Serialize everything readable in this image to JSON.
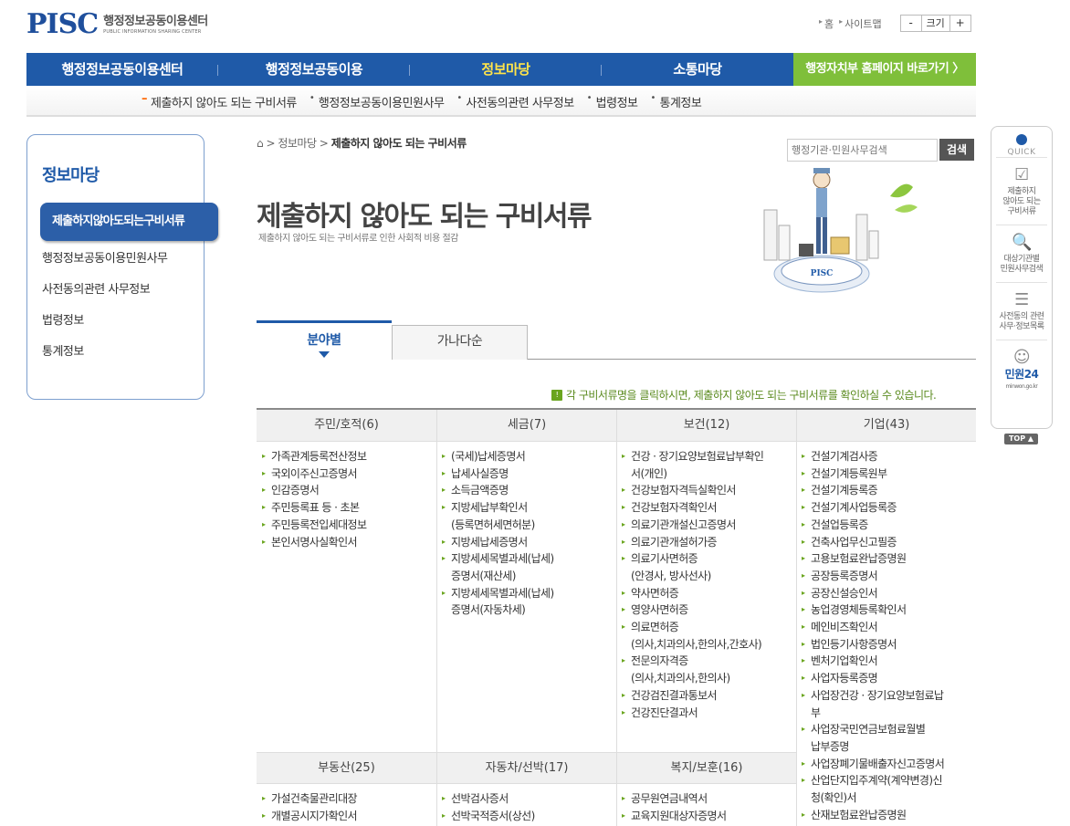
{
  "header": {
    "logo_mark": "PISC",
    "logo_ko": "행정정보공동이용센터",
    "logo_en": "PUBLIC INFORMATION SHARING CENTER",
    "util_home": "홈",
    "util_sitemap": "사이트맵",
    "font_minus": "-",
    "font_label": "크기",
    "font_plus": "+"
  },
  "gnb": {
    "items": [
      "행정정보공동이용센터",
      "행정정보공동이용",
      "정보마당",
      "소통마당"
    ],
    "gov_link": "행정자치부 홈페이지 바로가기 〉"
  },
  "subnav": [
    "제출하지 않아도 되는 구비서류",
    "행정정보공동이용민원사무",
    "사전동의관련 사무정보",
    "법령정보",
    "통계정보"
  ],
  "lnb": {
    "title": "정보마당",
    "active": "제출하지않아도되는구비서류",
    "items": [
      "행정정보공동이용민원사무",
      "사전동의관련 사무정보",
      "법령정보",
      "통계정보"
    ]
  },
  "breadcrumb": {
    "home": "⌂",
    "path": "> 정보마당 >",
    "current": "제출하지 않아도 되는 구비서류"
  },
  "search": {
    "placeholder": "행정기관·민원사무검색",
    "button": "검색"
  },
  "page": {
    "title": "제출하지 않아도 되는 구비서류",
    "subtitle": "제출하지 않아도 되는 구비서류로 인한 사회적 비용 절감",
    "illus_label": "PISC"
  },
  "tabs": [
    "분야별",
    "가나다순"
  ],
  "notice": {
    "icon": "!",
    "text": "각 구비서류명을 클릭하시면, 제출하지 않아도 되는 구비서류를 확인하실 수 있습니다."
  },
  "categories": {
    "c1": {
      "header": "주민/호적(6)",
      "items": [
        "가족관계등록전산정보",
        "국외이주신고증명서",
        "인감증명서",
        "주민등록표 등 · 초본",
        "주민등록전입세대정보",
        "본인서명사실확인서"
      ]
    },
    "c2": {
      "header": "세금(7)",
      "items": [
        "(국세)납세증명서",
        "납세사실증명",
        "소득금액증명",
        [
          "지방세납부확인서",
          "(등록면허세면허분)"
        ],
        "지방세납세증명서",
        [
          "지방세세목별과세(납세)",
          "증명서(재산세)"
        ],
        [
          "지방세세목별과세(납세)",
          "증명서(자동차세)"
        ]
      ]
    },
    "c3": {
      "header": "보건(12)",
      "items": [
        [
          "건강 · 장기요양보험료납부확인",
          "서(개인)"
        ],
        "건강보험자격득실확인서",
        "건강보험자격확인서",
        "의료기관개설신고증명서",
        "의료기관개설허가증",
        [
          "의료기사면허증",
          "(안경사, 방사선사)"
        ],
        "약사면허증",
        "영양사면허증",
        [
          "의료면허증",
          "(의사,치과의사,한의사,간호사)"
        ],
        [
          "전문의자격증",
          "(의사,치과의사,한의사)"
        ],
        "건강검진결과통보서",
        "건강진단결과서"
      ]
    },
    "c4": {
      "header": "기업(43)",
      "items": [
        "건설기계검사증",
        "건설기계등록원부",
        "건설기계등록증",
        "건설기계사업등록증",
        "건설업등록증",
        "건축사업무신고필증",
        "고용보험료완납증명원",
        "공장등록증명서",
        "공장신설승인서",
        "농업경영체등록확인서",
        "메인비즈확인서",
        "법인등기사항증명서",
        "벤처기업확인서",
        "사업자등록증명",
        [
          "사업장건강 · 장기요양보험료납",
          "부"
        ],
        [
          "사업장국민연금보험료월별",
          "납부증명"
        ],
        "사업장폐기물배출자신고증명서",
        [
          "산업단지입주계약(계약변경)신",
          "청(확인)서"
        ],
        "산재보험료완납증명원"
      ]
    },
    "c5": {
      "header": "부동산(25)",
      "items": [
        "가설건축물관리대장",
        "개별공시지가확인서"
      ]
    },
    "c6": {
      "header": "자동차/선박(17)",
      "items": [
        "선박검사증서",
        "선박국적증서(상선)"
      ]
    },
    "c7": {
      "header": "복지/보훈(16)",
      "items": [
        "공무원연금내역서",
        "교육지원대상자증명서"
      ]
    }
  },
  "quick": {
    "title": "QUICK",
    "items": [
      {
        "icon": "☑",
        "label": [
          "제출하지",
          "않아도 되는",
          "구비서류"
        ]
      },
      {
        "icon": "🔍",
        "label": [
          "대상기관별",
          "민원사무검색"
        ]
      },
      {
        "icon": "☰",
        "label": [
          "사전동의 관련",
          "사무·정보목록"
        ]
      },
      {
        "icon": "☺",
        "label": [
          "민원24",
          "minwon.go.kr"
        ]
      }
    ],
    "top": "TOP ▲"
  },
  "colors": {
    "primary": "#1f5aa8",
    "active_menu": "#ffe44a",
    "green": "#7fbf3a",
    "accent": "#ff6600"
  }
}
